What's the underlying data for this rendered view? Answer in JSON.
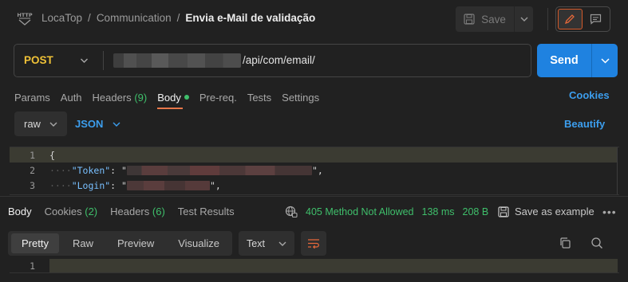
{
  "header": {
    "breadcrumb": [
      "LocaTop",
      "Communication"
    ],
    "separator": "/",
    "request_name": "Envia e-Mail de validação",
    "save_label": "Save"
  },
  "request": {
    "method": "POST",
    "url_visible": "/api/com/email/",
    "send_label": "Send"
  },
  "request_tabs": [
    {
      "label": "Params"
    },
    {
      "label": "Auth"
    },
    {
      "label": "Headers",
      "count": "(9)"
    },
    {
      "label": "Body",
      "active": true
    },
    {
      "label": "Pre-req."
    },
    {
      "label": "Tests"
    },
    {
      "label": "Settings"
    }
  ],
  "cookies_label": "Cookies",
  "body_options": {
    "mode": "raw",
    "format": "JSON",
    "beautify_label": "Beautify"
  },
  "editor": {
    "line_numbers": [
      "1",
      "2",
      "3"
    ],
    "open_brace": "{",
    "keys": [
      "\"Token\"",
      "\"Login\""
    ],
    "colon": ":",
    "quote": "\"",
    "line2_end": "\",",
    "line3_end": "\","
  },
  "response": {
    "tabs": [
      {
        "label": "Body",
        "active": true
      },
      {
        "label": "Cookies",
        "count": "(2)"
      },
      {
        "label": "Headers",
        "count": "(6)"
      },
      {
        "label": "Test Results"
      }
    ],
    "status": "405 Method Not Allowed",
    "time": "138 ms",
    "size": "208 B",
    "save_example_label": "Save as example",
    "more_label": "•••",
    "view_tabs": [
      "Pretty",
      "Raw",
      "Preview",
      "Visualize"
    ],
    "active_view": "Pretty",
    "format": "Text",
    "line_numbers": [
      "1"
    ]
  },
  "colors": {
    "accent_blue": "#1f82e0",
    "link_blue": "#3c9eee",
    "method_yellow": "#f0c237",
    "success_green": "#3fbf6b",
    "active_underline": "#e8774a"
  }
}
